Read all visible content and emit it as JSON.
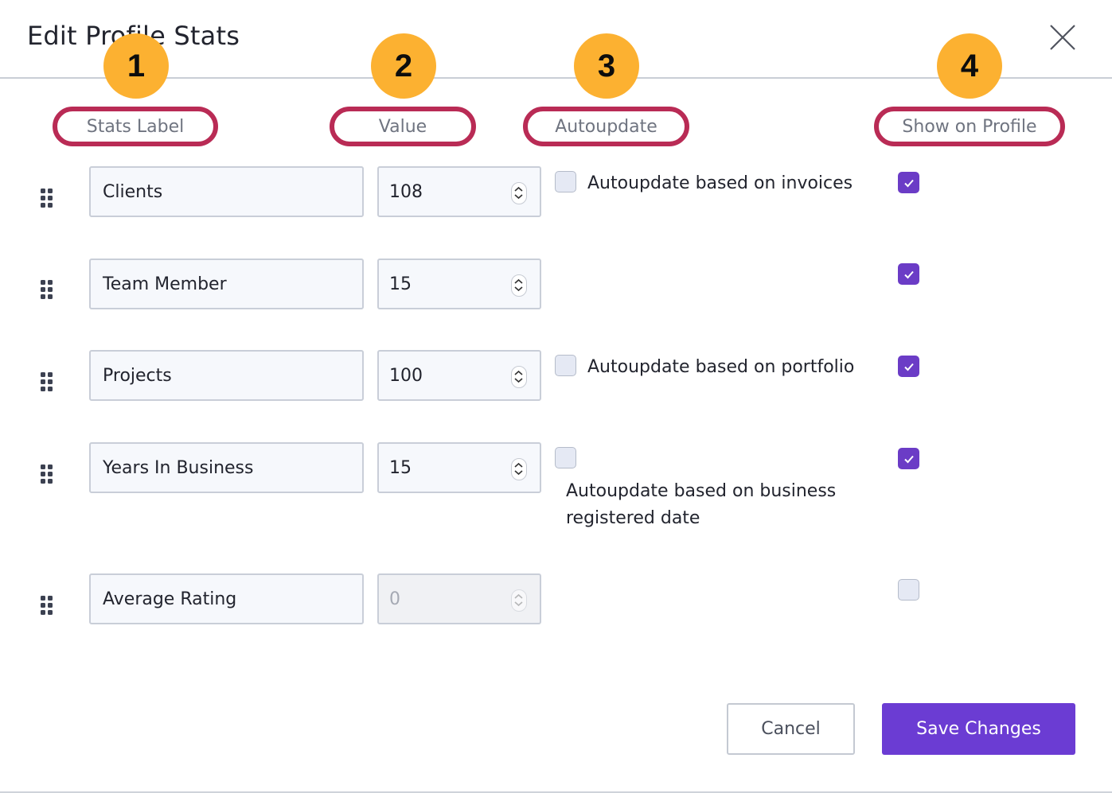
{
  "dialog": {
    "title": "Edit Profile Stats",
    "close_icon": "close-icon"
  },
  "columns": [
    {
      "label": "Stats Label",
      "badge": "1"
    },
    {
      "label": "Value",
      "badge": "2"
    },
    {
      "label": "Autoupdate",
      "badge": "3"
    },
    {
      "label": "Show on Profile",
      "badge": "4"
    }
  ],
  "rows": [
    {
      "label": "Clients",
      "value": "108",
      "autoupdate": {
        "present": true,
        "checked": false,
        "text": "Autoupdate based on invoices"
      },
      "show_on_profile": true
    },
    {
      "label": "Team Member",
      "value": "15",
      "autoupdate": {
        "present": false
      },
      "show_on_profile": true
    },
    {
      "label": "Projects",
      "value": "100",
      "autoupdate": {
        "present": true,
        "checked": false,
        "text": "Autoupdate based on portfolio"
      },
      "show_on_profile": true
    },
    {
      "label": "Years In Business",
      "value": "15",
      "autoupdate": {
        "present": true,
        "checked": false,
        "text_line1": "Autoupdate based on business",
        "text_line2": "registered date"
      },
      "show_on_profile": true
    },
    {
      "label": "Average Rating",
      "value": "0",
      "value_disabled": true,
      "autoupdate": {
        "present": false
      },
      "show_on_profile": false
    }
  ],
  "footer": {
    "cancel_label": "Cancel",
    "save_label": "Save Changes"
  },
  "colors": {
    "accent": "#6b3cd3",
    "badge": "#fcb131",
    "highlight_outline": "#b92b55"
  }
}
